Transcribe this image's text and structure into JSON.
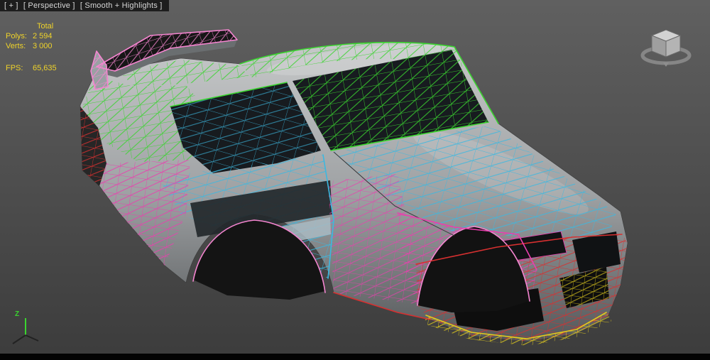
{
  "viewport": {
    "label_segments": {
      "menu": "[ + ]",
      "view": "[ Perspective ]",
      "shading": "[ Smooth + Highlights ]"
    },
    "stats": {
      "total_header": "Total",
      "rows": [
        {
          "label": "Polys:",
          "value": "2 594"
        },
        {
          "label": "Verts:",
          "value": "3 000"
        }
      ],
      "fps_label": "FPS:",
      "fps_value": "65,635"
    },
    "axis_gizmo": {
      "z_label": "Z"
    },
    "viewcube": {
      "name": "view-cube"
    }
  },
  "scene": {
    "object": "car-body-shell-wireframe"
  },
  "colors": {
    "stats_text": "#efd32a",
    "label_text": "#d8d8d8",
    "wire_green": "#3ad42f",
    "wire_cyan": "#3cb8e0",
    "wire_magenta": "#e93fae",
    "wire_pink": "#f585d0",
    "wire_red": "#d83030",
    "wire_yellow": "#e0ca1e",
    "bg_top": "#606060",
    "bg_bottom": "#3c3c3c"
  }
}
